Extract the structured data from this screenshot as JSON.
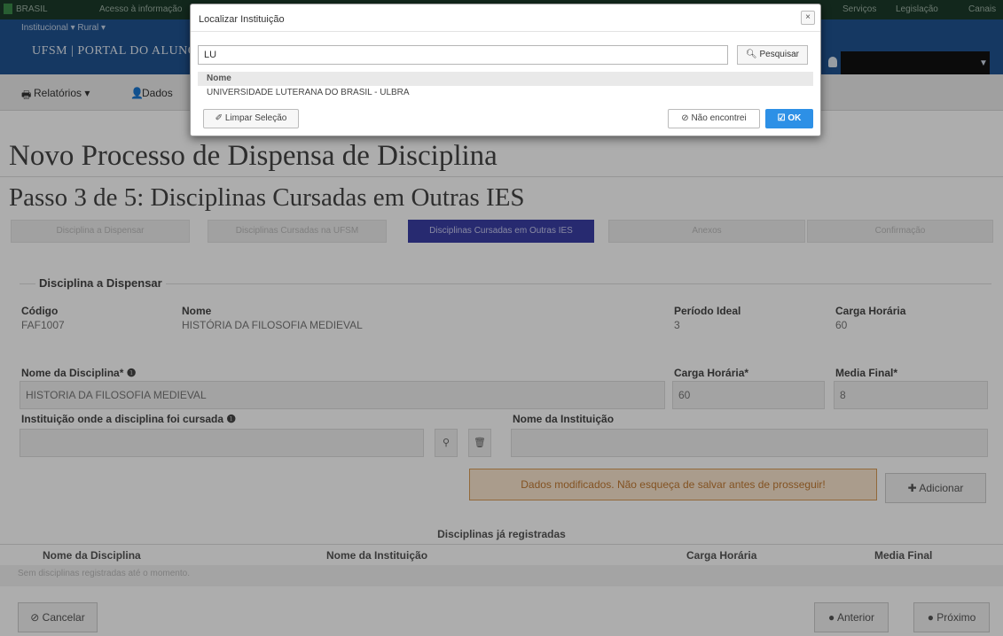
{
  "govbar": {
    "items": [
      "BRASIL",
      "Acesso à informação",
      "Serviços",
      "Legislação",
      "Canais"
    ]
  },
  "portal": {
    "breadcrumb": "Institucional ▾   Rural ▾",
    "title": "UFSM | PORTAL DO ALUNO"
  },
  "menu": {
    "reports": "Relatórios ▾",
    "data": "Dados"
  },
  "page": {
    "title": "Novo Processo de Dispensa de Disciplina",
    "step_title": "Passo 3 de 5: Disciplinas Cursadas em Outras IES",
    "steps": [
      "Disciplina a Dispensar",
      "Disciplinas Cursadas na UFSM",
      "Disciplinas Cursadas em Outras IES",
      "Anexos",
      "Confirmação"
    ],
    "active_step": 2
  },
  "discipline": {
    "legend": "Disciplina a Dispensar",
    "code_label": "Código",
    "code": "FAF1007",
    "name_label": "Nome",
    "name": "HISTÓRIA DA FILOSOFIA MEDIEVAL",
    "period_label": "Período Ideal",
    "period": "3",
    "hours_label": "Carga Horária",
    "hours": "60"
  },
  "form": {
    "discipline_name_label": "Nome da Disciplina*",
    "discipline_name": "HISTORIA DA FILOSOFIA MEDIEVAL",
    "hours_label": "Carga Horária*",
    "hours": "60",
    "grade_label": "Media Final*",
    "grade": "8",
    "institution_label": "Instituição onde a disciplina foi cursada",
    "institution_name_label": "Nome da Instituição",
    "alert": "Dados modificados. Não esqueça de salvar antes de prosseguir!",
    "add_button": "Adicionar"
  },
  "table": {
    "caption": "Disciplinas já registradas",
    "headers": [
      "Nome da Disciplina",
      "Nome da Instituição",
      "Carga Horária",
      "Media Final"
    ],
    "empty": "Sem disciplinas registradas até o momento."
  },
  "footer": {
    "cancel": "Cancelar",
    "previous": "Anterior",
    "next": "Próximo"
  },
  "modal": {
    "title": "Localizar Instituição",
    "search_value": "LU",
    "search_button": "Pesquisar",
    "column_header": "Nome",
    "results": [
      "UNIVERSIDADE LUTERANA DO BRASIL - ULBRA"
    ],
    "clear_button": "Limpar Seleção",
    "not_found_button": "Não encontrei",
    "ok_button": "OK"
  },
  "colors": {
    "header_blue": "#1f5391",
    "active_step": "#3a3fa6",
    "ok_button": "#2d90e6",
    "alert_bg": "#fbe6cf"
  }
}
